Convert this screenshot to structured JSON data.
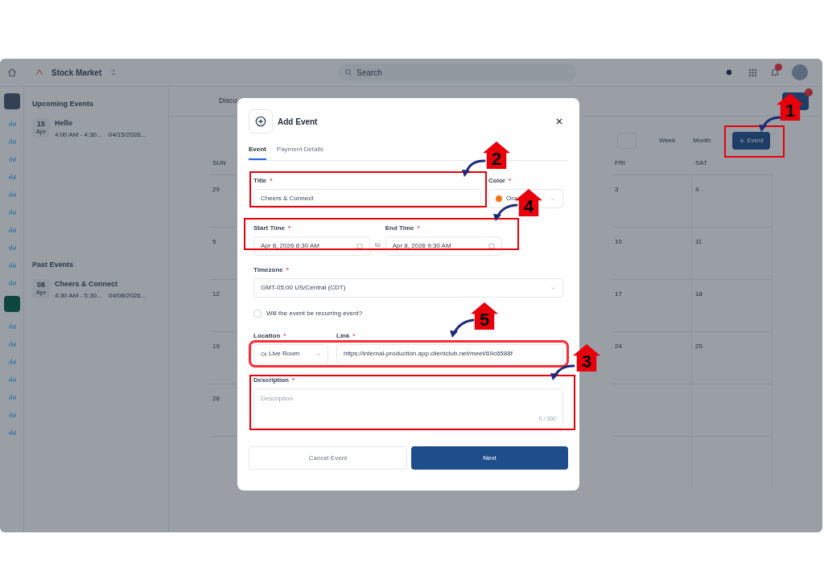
{
  "topbar": {
    "workspace": "Stock Market",
    "search_placeholder": "Search"
  },
  "upcoming": {
    "heading": "Upcoming Events",
    "events": [
      {
        "day": "15",
        "month": "Apr",
        "title": "Hello",
        "time": "4:00 AM - 4:30...",
        "date": "04/15/2026..."
      }
    ]
  },
  "past": {
    "heading": "Past Events",
    "events": [
      {
        "day": "08",
        "month": "Apr",
        "title": "Cheers & Connect",
        "time": "4:30 AM - 5:30...",
        "date": "04/08/2026..."
      }
    ]
  },
  "calendar": {
    "tab": "Disco",
    "views": [
      "Week",
      "Month"
    ],
    "add_button": "Event",
    "weekdays": [
      {
        "label": "SUN",
        "dates": [
          "29",
          "5",
          "12",
          "19",
          "26"
        ]
      },
      {
        "label": "FRI",
        "dates": [
          "3",
          "10",
          "17",
          "24"
        ]
      },
      {
        "label": "SAT",
        "dates": [
          "4",
          "11",
          "18",
          "25"
        ]
      }
    ]
  },
  "modal": {
    "title": "Add Event",
    "tabs": [
      {
        "label": "Event",
        "selected": true
      },
      {
        "label": "Payment Details",
        "selected": false
      }
    ],
    "title_field": {
      "label": "Title",
      "mark": "*",
      "value": "Cheers & Connect"
    },
    "color_field": {
      "label": "Color",
      "mark": "*",
      "value": "Ora",
      "color": "#f97316"
    },
    "start_field": {
      "label": "Start Time",
      "mark": "*",
      "value": "Apr 8, 2026 8:30 AM"
    },
    "separator": "to",
    "end_field": {
      "label": "End Time",
      "mark": "*",
      "value": "Apr 8, 2026 9:30 AM"
    },
    "timezone_field": {
      "label": "Timezone",
      "mark": "*",
      "value": "GMT-05:00 US/Central (CDT)"
    },
    "recurring": {
      "label": "Will the event be recurring event?",
      "checked": false
    },
    "location_field": {
      "label": "Location",
      "mark": "*",
      "value": "Live Room"
    },
    "link_field": {
      "label": "Link",
      "mark": "*",
      "value": "https://internal-production.app.clientclub.net/meet/69c6588f"
    },
    "description_field": {
      "label": "Description",
      "mark": "*",
      "placeholder": "Description",
      "counter": "0 / 300"
    },
    "cancel_button": "Cancel Event",
    "next_button": "Next"
  },
  "annotations": [
    {
      "number": "1"
    },
    {
      "number": "2"
    },
    {
      "number": "3"
    },
    {
      "number": "4"
    },
    {
      "number": "5"
    }
  ]
}
